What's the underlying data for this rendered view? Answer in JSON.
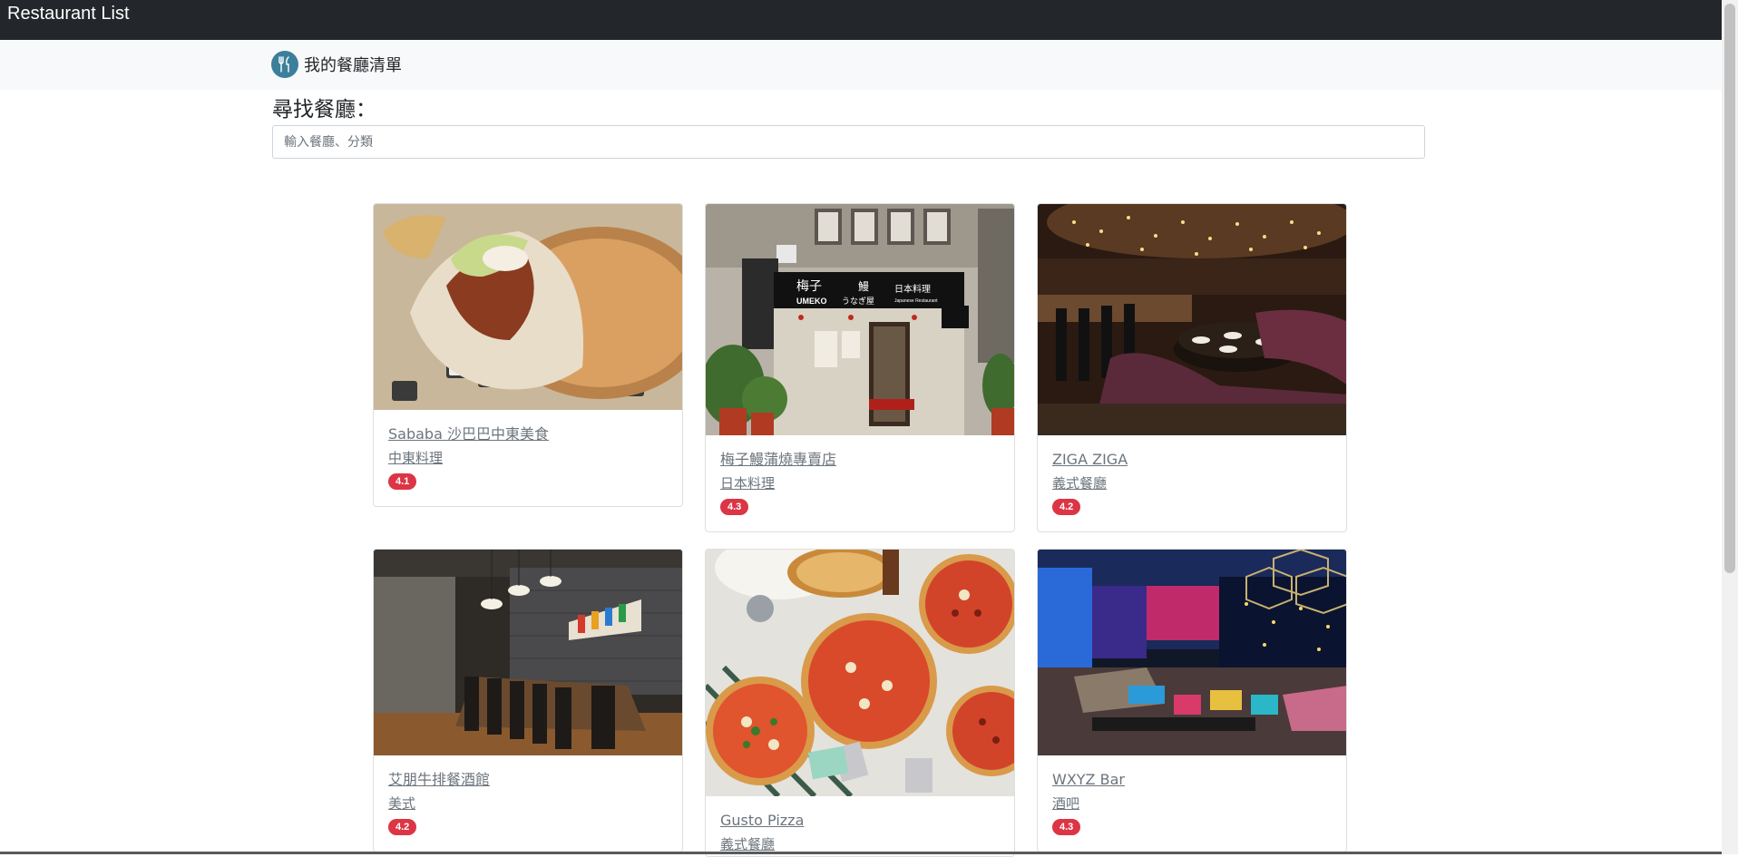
{
  "app": {
    "title": "Restaurant List"
  },
  "brand": {
    "name": "我的餐廳清單",
    "icon": "fork-knife-icon"
  },
  "search": {
    "label": "尋找餐廳：",
    "placeholder": "輸入餐廳、分類",
    "value": ""
  },
  "restaurants": [
    {
      "name": "Sababa 沙巴巴中東美食",
      "category": "中東料理",
      "rating": "4.1"
    },
    {
      "name": "梅子鰻蒲燒專賣店",
      "category": "日本料理",
      "rating": "4.3"
    },
    {
      "name": "ZIGA ZIGA",
      "category": "義式餐廳",
      "rating": "4.2"
    },
    {
      "name": "艾朋牛排餐酒館",
      "category": "美式",
      "rating": "4.2"
    },
    {
      "name": "Gusto Pizza",
      "category": "義式餐廳",
      "rating": ""
    },
    {
      "name": "WXYZ Bar",
      "category": "酒吧",
      "rating": "4.3"
    }
  ],
  "storefront_sign": {
    "main": "梅子",
    "sub": "UMEKO",
    "eel": "鰻",
    "kana": "うなぎ屋",
    "jp": "日本料理",
    "en": "Japanese Restaurant"
  },
  "colors": {
    "navbar": "#23272b",
    "brand_bg": "#f8f9fa",
    "badge": "#dc3545",
    "link": "#6c757d"
  }
}
